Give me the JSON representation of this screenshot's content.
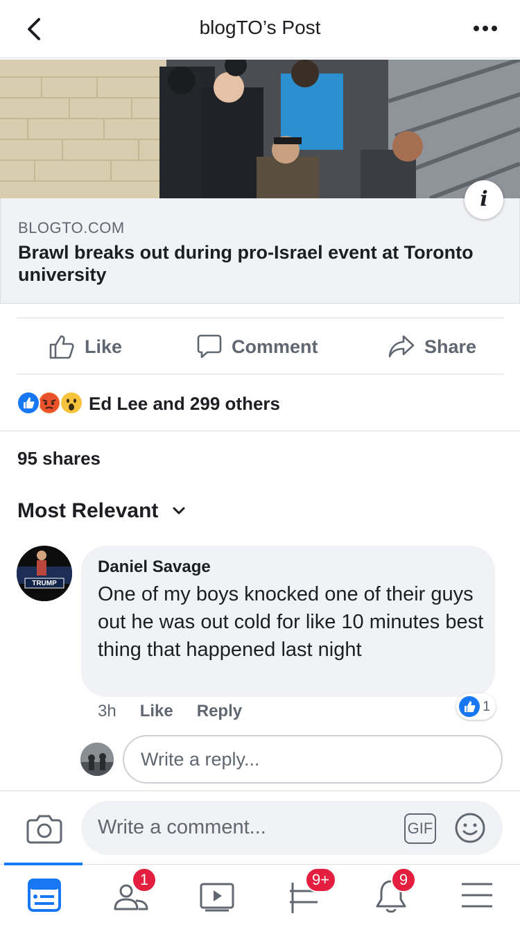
{
  "header": {
    "title": "blogTO’s Post"
  },
  "link_preview": {
    "domain": "BLOGTO.COM",
    "headline": "Brawl breaks out during pro-Israel event at Toronto university"
  },
  "actions": {
    "like": "Like",
    "comment": "Comment",
    "share": "Share"
  },
  "reactions": {
    "summary": "Ed Lee and 299 others",
    "types": [
      "like",
      "angry",
      "wow"
    ]
  },
  "shares": "95 shares",
  "sort": {
    "label": "Most Relevant"
  },
  "comment": {
    "author": "Daniel Savage",
    "text": "One of my boys knocked one of their guys out he was out cold for like 10 minutes best thing that happened last night",
    "time": "3h",
    "like_label": "Like",
    "reply_label": "Reply",
    "reaction_count": "1",
    "avatar_text": "TRUMP"
  },
  "reply_box": {
    "placeholder": "Write a reply..."
  },
  "composer": {
    "placeholder": "Write a comment...",
    "gif_label": "GIF"
  },
  "tabbar": {
    "friends_badge": "1",
    "marketplace_badge": "9+",
    "notifications_badge": "9"
  },
  "colors": {
    "accent": "#1877f2",
    "badge": "#e41e3f",
    "angry": "#f0772b",
    "wow": "#f7c33c"
  }
}
